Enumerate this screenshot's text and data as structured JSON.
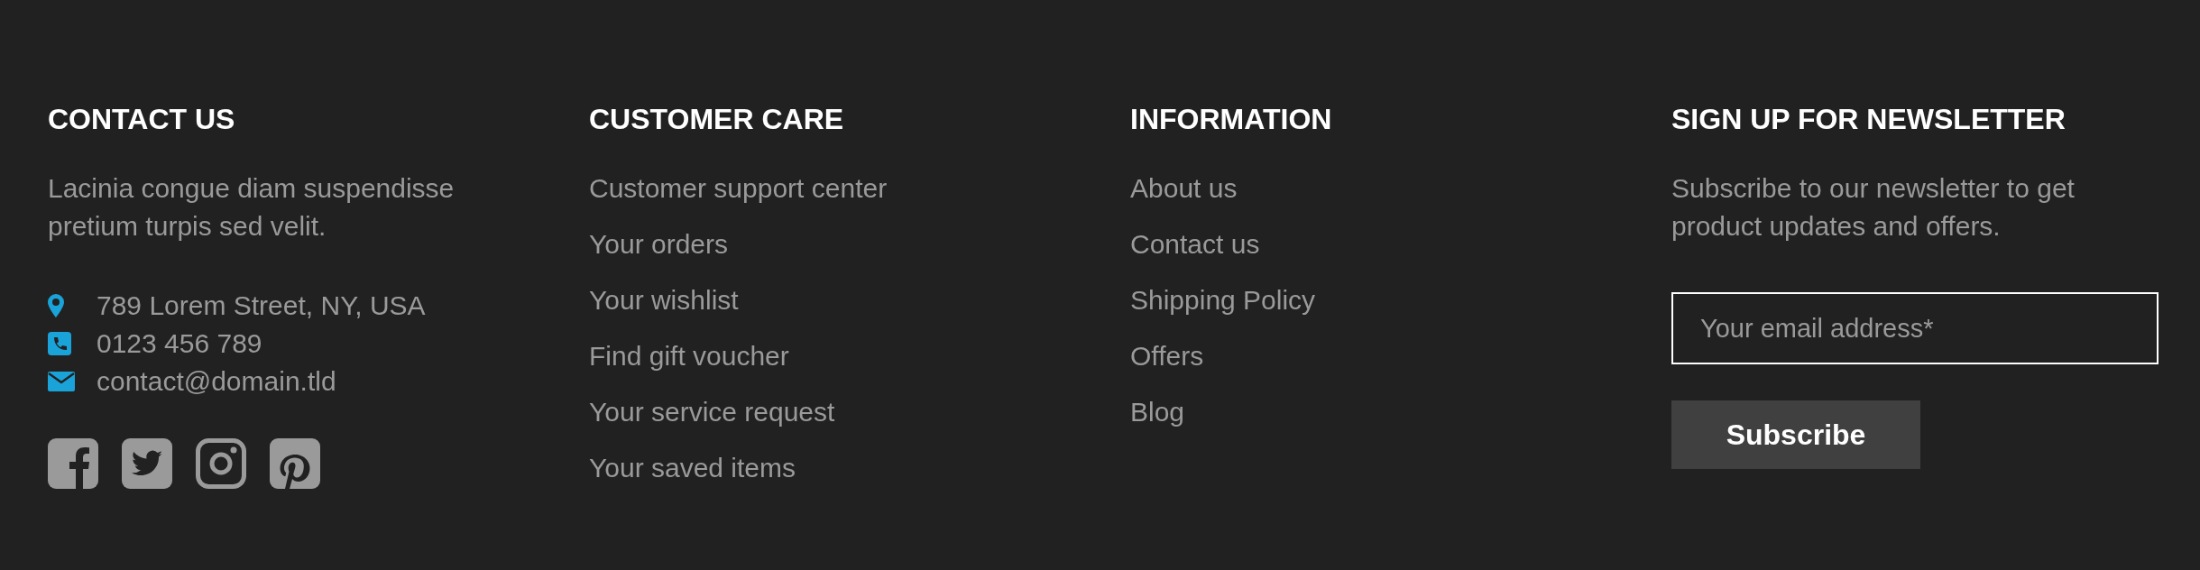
{
  "contact": {
    "heading": "CONTACT US",
    "text": "Lacinia congue diam suspendisse pretium turpis sed velit.",
    "items": [
      {
        "kind": "address",
        "text": "789 Lorem Street, NY, USA"
      },
      {
        "kind": "phone",
        "text": "0123 456 789"
      },
      {
        "kind": "email",
        "text": "contact@domain.tld"
      }
    ],
    "social": [
      {
        "kind": "facebook"
      },
      {
        "kind": "twitter"
      },
      {
        "kind": "instagram"
      },
      {
        "kind": "pinterest"
      }
    ]
  },
  "customer_care": {
    "heading": "CUSTOMER CARE",
    "links": [
      "Customer support center",
      "Your orders",
      "Your wishlist",
      "Find gift voucher",
      "Your service request",
      "Your saved items"
    ]
  },
  "information": {
    "heading": "INFORMATION",
    "links": [
      "About us",
      "Contact us",
      "Shipping Policy",
      "Offers",
      "Blog"
    ]
  },
  "newsletter": {
    "heading": "SIGN UP FOR NEWSLETTER",
    "text": "Subscribe to our newsletter to get product updates and offers.",
    "placeholder": "Your email address*",
    "button": "Subscribe"
  }
}
